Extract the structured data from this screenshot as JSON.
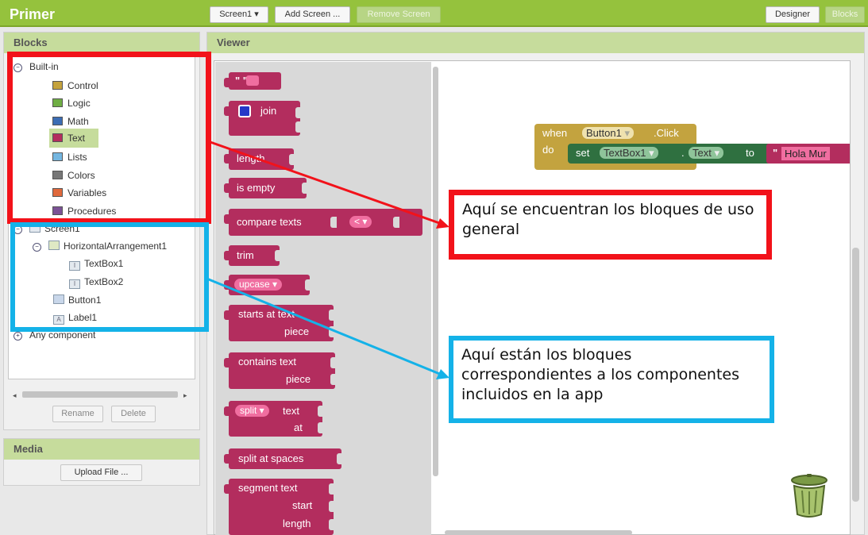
{
  "app": {
    "title": "Primer"
  },
  "toolbar": {
    "screen_select": "Screen1",
    "add_screen": "Add Screen ...",
    "remove_screen": "Remove Screen",
    "designer": "Designer",
    "blocks": "Blocks"
  },
  "blocks_panel": {
    "header": "Blocks",
    "builtin_label": "Built-in",
    "builtin_items": [
      {
        "label": "Control",
        "color": "#c4a23d"
      },
      {
        "label": "Logic",
        "color": "#6fae44"
      },
      {
        "label": "Math",
        "color": "#3c6db4"
      },
      {
        "label": "Text",
        "color": "#b32d5e"
      },
      {
        "label": "Lists",
        "color": "#74b6e0"
      },
      {
        "label": "Colors",
        "color": "#777777"
      },
      {
        "label": "Variables",
        "color": "#e0693c"
      },
      {
        "label": "Procedures",
        "color": "#7b5296"
      }
    ],
    "screen_label": "Screen1",
    "components": {
      "arrangement": "HorizontalArrangement1",
      "textbox1": "TextBox1",
      "textbox2": "TextBox2",
      "button": "Button1",
      "label": "Label1"
    },
    "any_component": "Any component",
    "rename": "Rename",
    "delete": "Delete"
  },
  "media_panel": {
    "header": "Media",
    "upload": "Upload File ..."
  },
  "viewer": {
    "header": "Viewer",
    "flyout": {
      "join": "join",
      "length": "length",
      "is_empty": "is empty",
      "compare_texts": "compare texts",
      "compare_op": "<",
      "trim": "trim",
      "upcase": "upcase",
      "starts_at": "starts at text",
      "piece": "piece",
      "contains": "contains text",
      "split": "split",
      "text_word": "text",
      "at": "at",
      "split_spaces": "split at spaces",
      "segment": "segment text",
      "start": "start",
      "length_word": "length",
      "quote": "\" \""
    },
    "canvas": {
      "when": "when",
      "button": "Button1",
      "click": ".Click",
      "do": "do",
      "set": "set",
      "textbox": "TextBox1",
      "dot": ".",
      "prop": "Text",
      "to": "to",
      "text_value": "Hola Mur",
      "quote": "\""
    }
  },
  "annotations": {
    "red": "Aquí se encuentran los bloques de uso general",
    "blue": "Aquí están los bloques correspondientes a los componentes incluidos en la app",
    "red_color": "#f2121a",
    "blue_color": "#14b2e8"
  }
}
